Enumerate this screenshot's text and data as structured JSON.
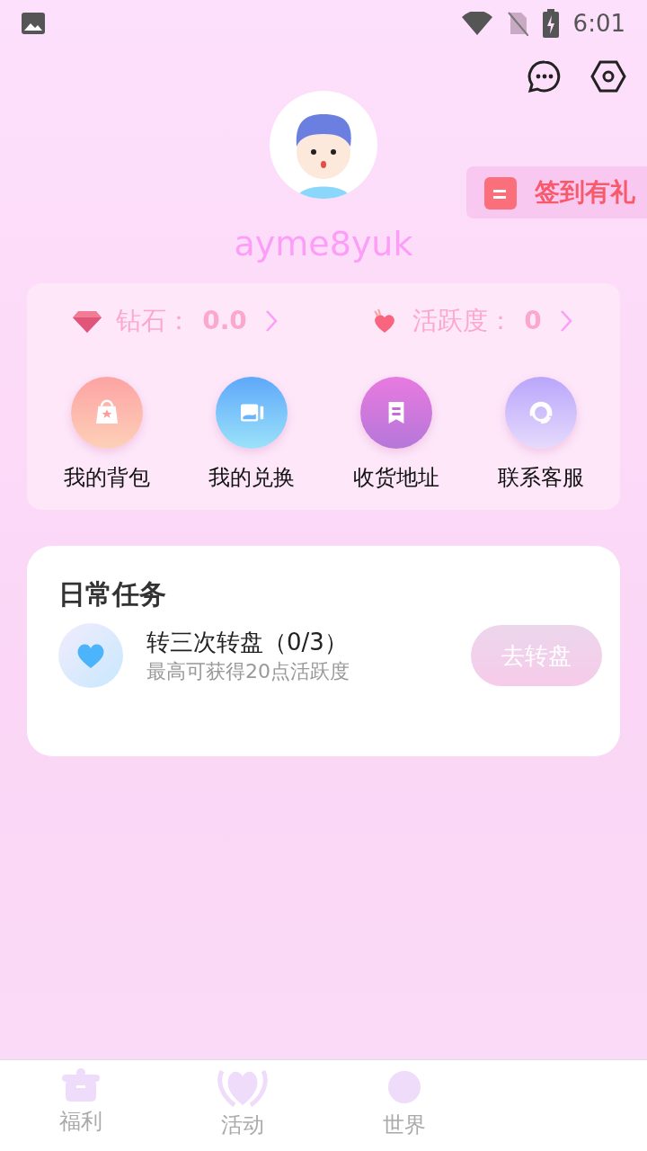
{
  "status_bar": {
    "time": "6:01"
  },
  "profile": {
    "username": "ayme8yuk"
  },
  "sign_in_badge": {
    "label": "签到有礼"
  },
  "stats": [
    {
      "kind": "diamond",
      "label": "钻石：",
      "value": "0.0"
    },
    {
      "kind": "activity",
      "label": "活跃度：",
      "value": "0"
    }
  ],
  "shortcuts": [
    {
      "kind": "bag",
      "label": "我的背包"
    },
    {
      "kind": "exchange",
      "label": "我的兑换"
    },
    {
      "kind": "address",
      "label": "收货地址"
    },
    {
      "kind": "service",
      "label": "联系客服"
    }
  ],
  "daily_tasks": {
    "title": "日常任务",
    "tasks": [
      {
        "title": "转三次转盘（0/3）",
        "subtitle": "最高可获得20点活跃度",
        "button": "去转盘",
        "disabled": true
      }
    ]
  },
  "bottom_nav": [
    {
      "kind": "gift",
      "label": "福利",
      "selected": false
    },
    {
      "kind": "heart",
      "label": "活动",
      "selected": false
    },
    {
      "kind": "world",
      "label": "世界",
      "selected": false
    }
  ]
}
